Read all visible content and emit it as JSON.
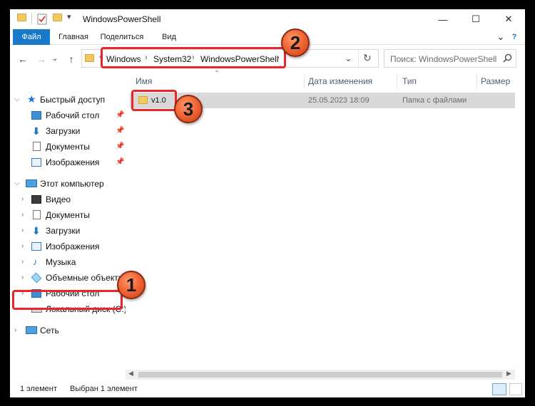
{
  "window": {
    "title": "WindowsPowerShell",
    "controls": {
      "minimize": "—",
      "maximize": "☐",
      "close": "✕"
    }
  },
  "ribbon": {
    "tabs": [
      "Файл",
      "Главная",
      "Поделиться",
      "Вид"
    ],
    "expand_icon": "⌄",
    "help_icon": "?"
  },
  "address": {
    "overflow": "«",
    "breadcrumbs": [
      "Windows",
      "System32",
      "WindowsPowerShell"
    ],
    "separator": "›",
    "dropdown": "⌄",
    "refresh": "↻"
  },
  "search": {
    "placeholder": "Поиск: WindowsPowerShell"
  },
  "nav_buttons": {
    "back": "←",
    "forward": "→",
    "history": "⌄",
    "up": "↑"
  },
  "navigation": {
    "quick_access": {
      "label": "Быстрый доступ",
      "items": [
        "Рабочий стол",
        "Загрузки",
        "Документы",
        "Изображения"
      ]
    },
    "this_pc": {
      "label": "Этот компьютер",
      "items": [
        "Видео",
        "Документы",
        "Загрузки",
        "Изображения",
        "Музыка",
        "Объемные объекты",
        "Рабочий стол",
        "Локальный диск (C:)"
      ]
    },
    "network": {
      "label": "Сеть"
    }
  },
  "columns": {
    "name": "Имя",
    "date": "Дата изменения",
    "type": "Тип",
    "size": "Размер"
  },
  "files": [
    {
      "name": "v1.0",
      "date": "25.05.2023 18:09",
      "type": "Папка с файлами",
      "size": ""
    }
  ],
  "statusbar": {
    "count": "1 элемент",
    "selected": "Выбран 1 элемент"
  },
  "annotations": {
    "badge1": "1",
    "badge2": "2",
    "badge3": "3"
  },
  "colors": {
    "accent": "#1979ca",
    "highlight": "#e8262c",
    "badge": "#f26838"
  }
}
